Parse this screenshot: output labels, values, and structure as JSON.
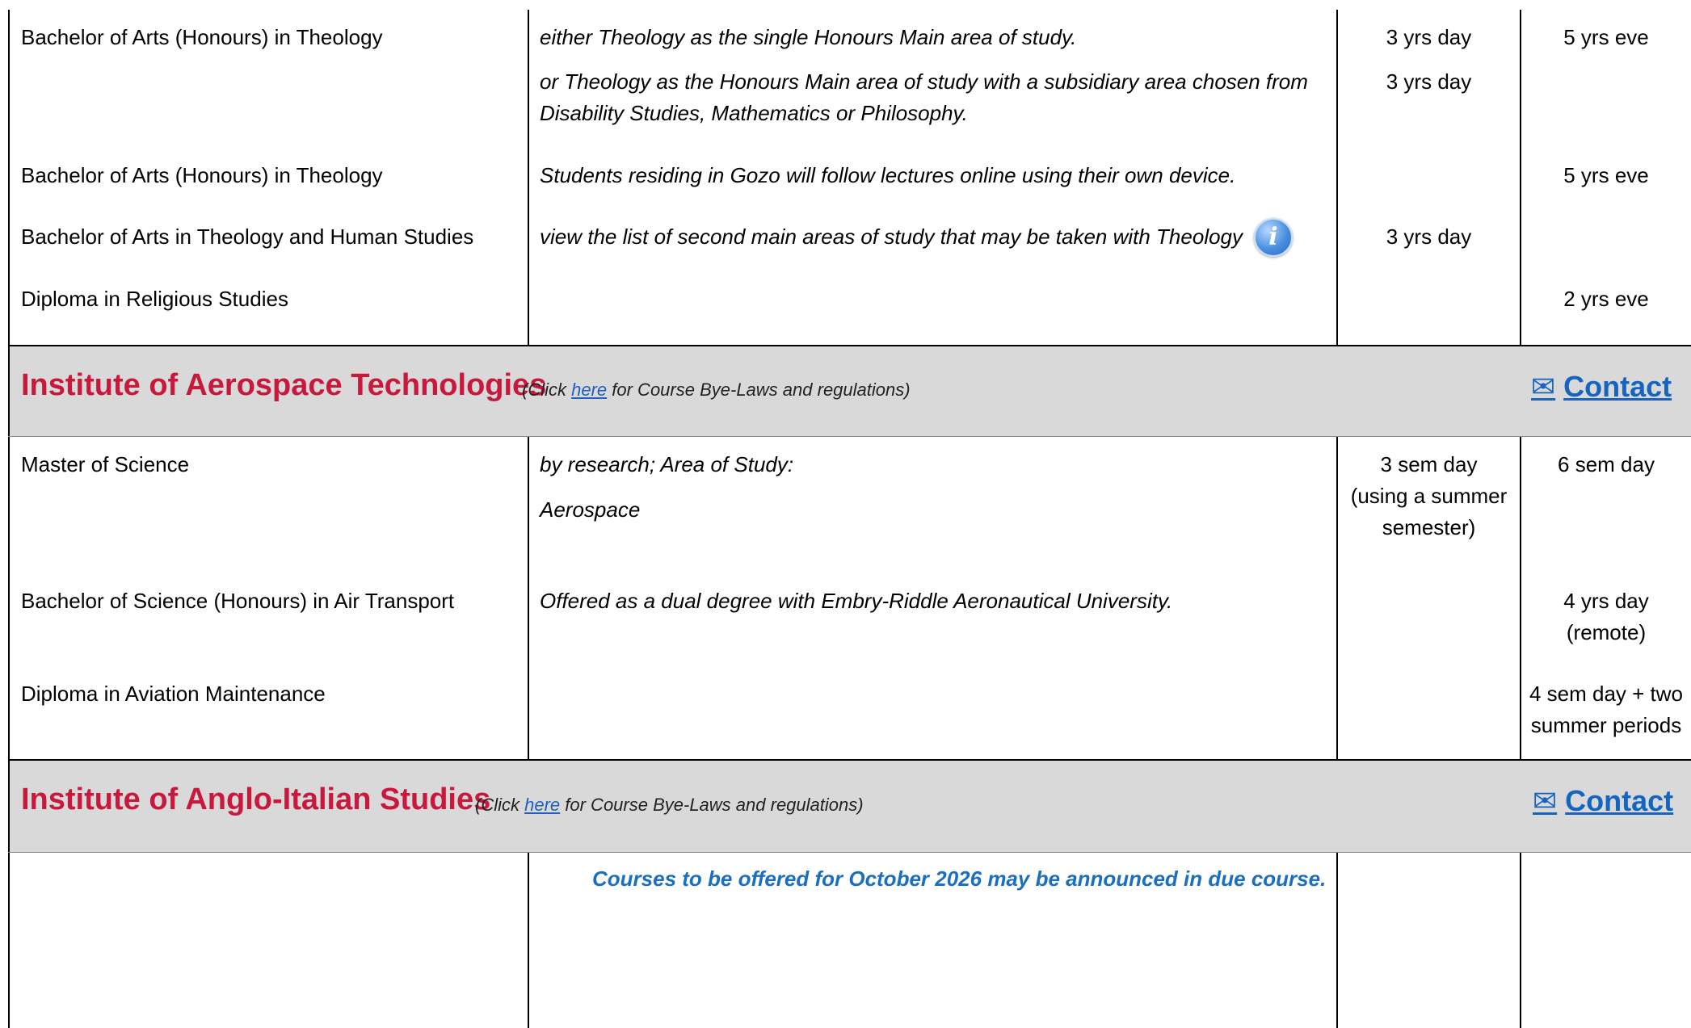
{
  "theology_rows": [
    {
      "course": "Bachelor of Arts (Honours) in Theology",
      "notes": [
        "either Theology as the single Honours Main area of study.",
        "or Theology as the Honours Main area of study with a subsidiary area chosen from",
        "Disability Studies, Mathematics or Philosophy."
      ],
      "full_time": [
        "3 yrs day",
        "3 yrs day"
      ],
      "part_time": "5 yrs eve"
    },
    {
      "course": "Bachelor of Arts (Honours) in Theology",
      "notes": [
        "Students residing in Gozo will follow lectures online using their own device."
      ],
      "full_time": [],
      "part_time": "5 yrs eve"
    },
    {
      "course": "Bachelor of Arts in Theology and Human Studies",
      "notes": [
        "view the list of second main areas of study that may be taken with Theology"
      ],
      "info_icon": "info-icon",
      "full_time": [
        "3 yrs day"
      ],
      "part_time": ""
    },
    {
      "course": "Diploma in Religious Studies",
      "notes": [],
      "full_time": [],
      "part_time": "2 yrs eve"
    }
  ],
  "institutes": [
    {
      "title": "Institute of Aerospace Technologies",
      "note_prefix": "(Click ",
      "note_link": "here",
      "note_suffix": " for Course Bye-Laws and regulations)",
      "contact_icon": "envelope-icon",
      "contact_label": "Contact",
      "rows": [
        {
          "course": "Master of Science",
          "notes": [
            "by research; Area of Study:",
            "Aerospace"
          ],
          "full_time": [
            "3 sem day",
            "(using a summer",
            "semester)"
          ],
          "part_time": [
            "6 sem day"
          ]
        },
        {
          "course": "Bachelor of Science (Honours) in Air Transport",
          "notes": [
            "Offered as a dual degree with Embry-Riddle Aeronautical University."
          ],
          "full_time": [],
          "part_time": [
            "4 yrs day",
            "(remote)"
          ]
        },
        {
          "course": "Diploma in Aviation Maintenance",
          "notes": [],
          "full_time": [],
          "part_time": [
            "4 sem day + two",
            "summer periods"
          ]
        }
      ]
    },
    {
      "title": "Institute of Anglo-Italian Studies",
      "note_prefix": "(Click ",
      "note_link": "here",
      "note_suffix": " for Course Bye-Laws and regulations)",
      "contact_icon": "envelope-icon",
      "contact_label": "Contact",
      "announcement": "Courses to be offered for October 2026 may be announced in due course."
    }
  ],
  "colors": {
    "institute_title": "#c8193c",
    "contact": "#1565c0",
    "section_bg": "#d9d9d9",
    "announcement": "#1a6fc0"
  }
}
